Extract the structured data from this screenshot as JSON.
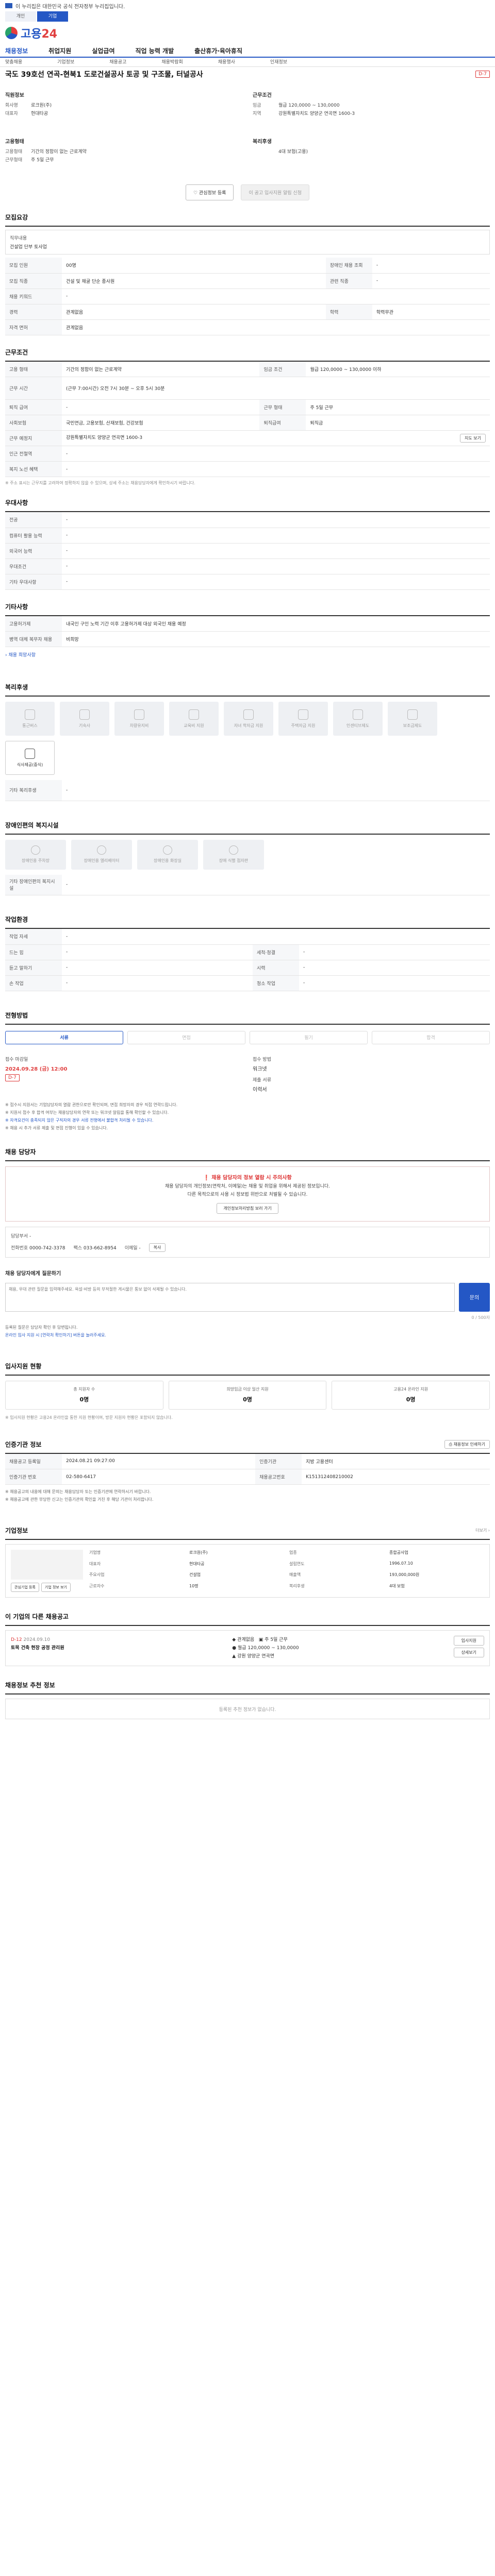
{
  "top_notice": "이 누리집은 대한민국 공식 전자정부 누리집입니다.",
  "gov_tabs": [
    "개인",
    "기업"
  ],
  "logo": {
    "text": "고용",
    "num": "24"
  },
  "gnb": [
    "채용정보",
    "취업지원",
    "실업급여",
    "직업 능력 개발",
    "출산휴가·육아휴직"
  ],
  "sub_nav": [
    "맞춤채용",
    "기업정보",
    "채용공고",
    "채용박람회",
    "채용행사",
    "인재정보"
  ],
  "job": {
    "title": "국도 39호선 연곡-현북1 도로건설공사 토공 및 구조물, 터널공사",
    "dday": "D-7"
  },
  "summary": {
    "company_h": "직원정보",
    "company_rows": [
      [
        "회사명",
        "로크원(주)"
      ],
      [
        "대표자",
        "현대타공"
      ]
    ],
    "condition_h": "근무조건",
    "condition_rows": [
      [
        "임금",
        "월급 120,0000 ~ 130,0000"
      ],
      [
        "지역",
        "강원특별자치도 양양군 연곡면 1600-3"
      ]
    ],
    "emp_h": "고용형태",
    "emp_rows": [
      [
        "고용형태",
        "기간의 정함이 없는 근로계약"
      ],
      [
        "근무형태",
        "주 5일 근무"
      ]
    ],
    "career_h": "복리후생",
    "career_rows": [
      [
        "",
        "4대 보험(고용)"
      ]
    ]
  },
  "actions": {
    "bookmark": "관심정보 등록",
    "share": "이 공고 입사지원 알림 신청"
  },
  "recruit": {
    "title": "모집요강",
    "duty_label": "직무내용",
    "duty": "건설업 단부 토사업",
    "rows": [
      [
        "모집 인원",
        "00명",
        "장애인 채용 조회",
        "-"
      ],
      [
        "모집 직종",
        "건설 및 채굴 단순 종사원",
        "관련 직종",
        "-"
      ],
      [
        "채용 키워드",
        "-",
        "",
        ""
      ],
      [
        "경력",
        "관계없음",
        "학력",
        "학력무관"
      ],
      [
        "자격 면허",
        "관계없음",
        "",
        ""
      ]
    ]
  },
  "work": {
    "title": "근무조건",
    "rows": [
      [
        "고용 형태",
        "기간의 정함이 없는 근로계약",
        "임금 조건",
        "월급 120,0000 ~ 130,0000 이하"
      ],
      [
        "근무 시간",
        "(근무 7:00시간) 오전 7시 30분 ~ 오후 5시 30분",
        "",
        ""
      ],
      [
        "퇴직 급여",
        "-",
        "근무 형태",
        "주 5일 근무"
      ],
      [
        "사회보험",
        "국민연금, 고용보험, 산재보험, 건강보험",
        "퇴직급여",
        "퇴직금"
      ],
      [
        "근무 예정지",
        "강원특별자치도 양양군 연곡면 1600-3",
        "",
        ""
      ],
      [
        "인근 전철역",
        "-",
        "",
        ""
      ],
      [
        "복지 노선 혜택",
        "-",
        "",
        ""
      ]
    ],
    "map_btn": "지도 보기",
    "note": "※ 주소 표시는 근무지를 고려하여 정확하지 않을 수 있으며, 상세 주소는 채용담당자에게 확인하시기 바랍니다."
  },
  "pref": {
    "title": "우대사항",
    "rows": [
      [
        "전공",
        "-"
      ],
      [
        "컴퓨터 활용 능력",
        "-"
      ],
      [
        "외국어 능력",
        "-"
      ],
      [
        "우대조건",
        "-"
      ],
      [
        "기타 우대사항",
        "-"
      ]
    ]
  },
  "etc": {
    "title": "기타사항",
    "rows": [
      [
        "고용허가제",
        "내국인 구인 노력 기간 이후 고용허가제 대상 외국인 채용 예정"
      ],
      [
        "병역 대체 복무자 채용",
        "비희망"
      ]
    ],
    "link": "채용 희망사항"
  },
  "welfare": {
    "title": "복리후생",
    "items": [
      "통근버스",
      "기숙사",
      "차량유지비",
      "교육비 지원",
      "자녀 학자금 지원",
      "주택자금 지원",
      "인센티브제도",
      "보조금제도",
      "식사제공(중식)"
    ],
    "active_index": 8,
    "other_label": "기타 복리후생",
    "other_value": "-"
  },
  "disabled": {
    "title": "장애인편의 복지시설",
    "items": [
      "장애인용 주차장",
      "장애인용 엘리베이터",
      "장애인용 화장실",
      "장애 식별 점자판"
    ],
    "other_label": "기타 장애인편의 복지시설",
    "other_value": "-"
  },
  "workplace": {
    "title": "작업환경",
    "rows": [
      [
        "작업 자세",
        "-",
        "",
        ""
      ],
      [
        "드는 힘",
        "-",
        "세척·청결",
        "-"
      ],
      [
        "듣고 말하기",
        "-",
        "시력",
        "-"
      ],
      [
        "손 작업",
        "-",
        "청소 작업",
        "-"
      ]
    ]
  },
  "process": {
    "title": "전형방법",
    "steps": [
      "서류",
      "면접",
      "필기",
      "합격"
    ],
    "active": 0,
    "deadline_label": "접수 마감일",
    "deadline": "2024.09.28 (금) 12:00",
    "dday": "D-7",
    "method_label": "접수 방법",
    "method": "워크넷",
    "docs_label": "제출 서류",
    "docs": "이력서",
    "notes": [
      "※ 접수시 지원서는 기업담당자의 열람 권한으로만 확인되며, 면접 희망자의 경우 직접 연락드립니다.",
      "※ 지원서 접수 후 합격 여부는 채용담당자의 연락 또는 워크넷 알림을 통해 확인할 수 있습니다.",
      "※ 자격요건이 충족되지 않은 구직자의 경우 서류 전형에서 불합격 처리될 수 있습니다.",
      "※ 채용 시 추가 서류 제출 및 면접 진행이 있을 수 있습니다."
    ]
  },
  "manager": {
    "title": "채용 담당자",
    "warn_title": "채용 담당자의 정보 열람 시 주의사항",
    "warn_body": "채용 담당자의 개인정보(연락처, 이메일)는 채용 및 취업을 위해서 제공된 정보입니다.",
    "warn_body2": "다른 목적으로의 사용 시 정보법 위반으로 처벌될 수 있습니다.",
    "warn_btn": "개인정보처리방침 보러 가기",
    "dept_label": "담당부서",
    "dept": "-",
    "phone_label": "전화번호",
    "phone": "0000-742-3378",
    "fax_label": "팩스",
    "fax": "033-662-8954",
    "email_label": "이메일",
    "email": "-",
    "copy_btn": "복사"
  },
  "inquiry": {
    "title": "채용 담당자에게 질문하기",
    "placeholder": "채용, 우대 관련 질문을 입력해주세요. 욕설·비방 등의 부적절한 게시물은 통보 없이 삭제될 수 있습니다.",
    "send": "문의",
    "count": "0 / 500자",
    "links": [
      "등록된 질문은 담당자 확인 후 답변됩니다.",
      "온라인 입사 지원 시 [연락처 확인하기] 버튼을 눌러주세요."
    ]
  },
  "applicants": {
    "title": "입사지원 현황",
    "cards": [
      [
        "총 지원자 수",
        "0명"
      ],
      [
        "희망임금 이상 일산 지원",
        "0명"
      ],
      [
        "고용24 온라인 지원",
        "0명"
      ]
    ],
    "note": "※ 입사지원 현황은 고용24 온라인을 통한 지원 현황이며, 방문 지원자 현황은 포함되지 않습니다."
  },
  "info": {
    "title": "인증기관 정보",
    "print": "채용정보 인쇄하기",
    "rows": [
      [
        "채용공고 등록일",
        "2024.08.21 09:27:00",
        "인증기관",
        "지방 고용센터"
      ],
      [
        "인증기관 번호",
        "02-580-6417",
        "채용공고번호",
        "K151312408210002"
      ]
    ],
    "notes": [
      "※ 채용공고의 내용에 대해 문의는 채용담당자 또는 인증기관에 연락하시기 바랍니다.",
      "※ 채용공고에 관한 부당한 신고는 인증기관의 확인을 거친 후 해당 기관이 처리합니다."
    ]
  },
  "company_info": {
    "title": "기업정보",
    "more": "더보기",
    "rows": [
      [
        "기업명",
        "로크원(주)",
        "업종",
        "종합공사업"
      ],
      [
        "대표자",
        "현대타공",
        "설립연도",
        "1996.07.10"
      ],
      [
        "주요사업",
        "건설업",
        "매출액",
        "193,000,000원"
      ],
      [
        "근로자수",
        "10명",
        "복리후생",
        "4대 보험"
      ]
    ],
    "btns": [
      "관심기업 등록",
      "기업 정보 보기"
    ]
  },
  "other_jobs": {
    "title": "이 기업의 다른 채용공고",
    "subtitle": "",
    "dday": "D-12",
    "date": "2024.09.10",
    "title_text": "토목 건축 현장 공정 관리원",
    "condition1": "관계없음",
    "condition2": "주 5일 근무",
    "wage": "월급 120,0000 ~ 130,0000",
    "place": "강원 양양군 연곡면",
    "btns": [
      "입사지원",
      "상세보기"
    ]
  },
  "other_info": {
    "title": "채용정보 추천 정보",
    "empty": "등록된 추천 정보가 없습니다."
  }
}
